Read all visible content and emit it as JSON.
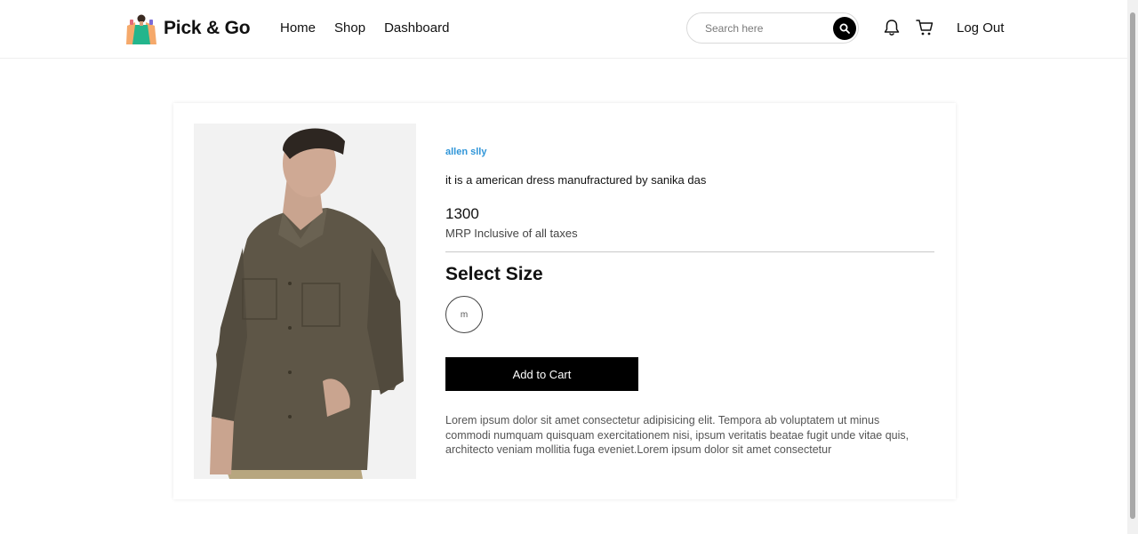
{
  "header": {
    "logo_text": "Pick & Go",
    "nav": [
      "Home",
      "Shop",
      "Dashboard"
    ],
    "search": {
      "placeholder": "Search here",
      "value": ""
    },
    "logout_label": "Log Out",
    "icons": [
      "search-icon",
      "bell-icon",
      "cart-icon"
    ]
  },
  "product": {
    "brand": "allen slly",
    "description": "it is a american dress manufractured by sanika das",
    "price": "1300",
    "price_note": "MRP Inclusive of all taxes",
    "size_heading": "Select Size",
    "sizes": [
      "m"
    ],
    "add_to_cart_label": "Add to Cart",
    "long_description": "Lorem ipsum dolor sit amet consectetur adipisicing elit. Tempora ab voluptatem ut minus commodi numquam quisquam exercitationem nisi, ipsum veritatis beatae fugit unde vitae quis, architecto veniam mollitia fuga eveniet.Lorem ipsum dolor sit amet consectetur"
  },
  "colors": {
    "brand_link": "#2f95d8",
    "button_bg": "#000000",
    "shirt": "#5e5647",
    "skin": "#c9a48f",
    "pants": "#b7a67f"
  }
}
